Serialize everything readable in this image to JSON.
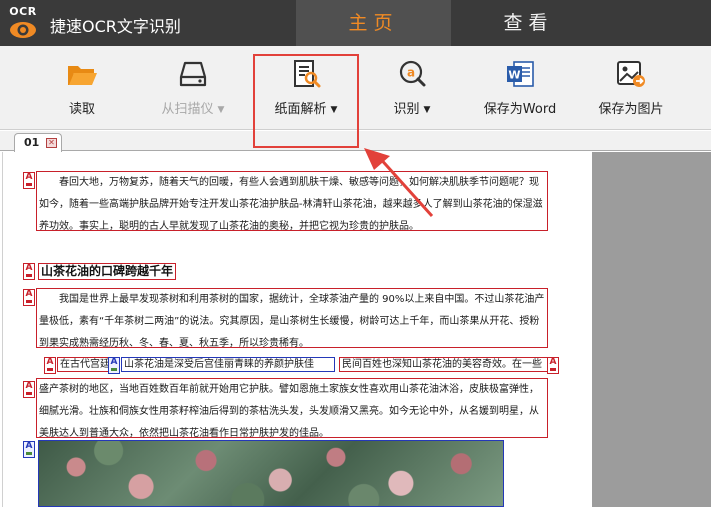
{
  "app": {
    "logo_text": "OCR",
    "title": "捷速OCR文字识别"
  },
  "nav": {
    "home": "主页",
    "view": "查看"
  },
  "toolbar": {
    "read": "读取",
    "scan": "从扫描仪",
    "paper_analysis": "纸面解析",
    "recognize": "识别",
    "save_word": "保存为Word",
    "save_image": "保存为图片"
  },
  "doc_tab": {
    "label": "01"
  },
  "document": {
    "para1": "春回大地，万物复苏，随着天气的回暖，有些人会遇到肌肤干燥、敏感等问题，如何解决肌肤季节问题呢？现如今，随着一些高端护肤品牌开始专注开发山茶花油护肤品-林清轩山茶花油，越来越多人了解到山茶花油的保湿滋养功效。事实上，聪明的古人早就发现了山茶花油的奥秘，并把它视为珍贵的护肤品。",
    "heading": "山茶花油的口碑跨越千年",
    "para2": "我国是世界上最早发现茶树和利用茶树的国家，据统计，全球茶油产量的 90%以上来自中国。不过山茶花油产量极低，素有“千年茶树二两油”的说法。究其原因，是山茶树生长缓慢，树龄可达上千年，而山茶果从开花、授粉到果实成熟需经历秋、冬、春、夏、秋五季，所以珍贵稀有。",
    "line_a": "在古代宫廷",
    "line_b": "山茶花油是深受后宫佳丽青睐的养颜护肤佳品。",
    "line_c": "民间百姓也深知山茶花油的美容奇效。在一些",
    "para3": "盛产茶树的地区，当地百姓数百年前就开始用它护肤。譬如恩施土家族女性喜欢用山茶花油沐浴，皮肤极富弹性，细腻光滑。壮族和侗族女性用茶籽榨油后得到的茶枯洗头发，头发顺滑又黑亮。如今无论中外，从名媛到明星，从美肤达人到普通大众，依然把山茶花油看作日常护肤护发的佳品。",
    "marker_text": "A",
    "marker_img": "A"
  },
  "colors": {
    "accent": "#f08a24",
    "annotation_red": "#e2413a",
    "text_block_border": "#c8202a",
    "image_block_border": "#2438b8"
  }
}
